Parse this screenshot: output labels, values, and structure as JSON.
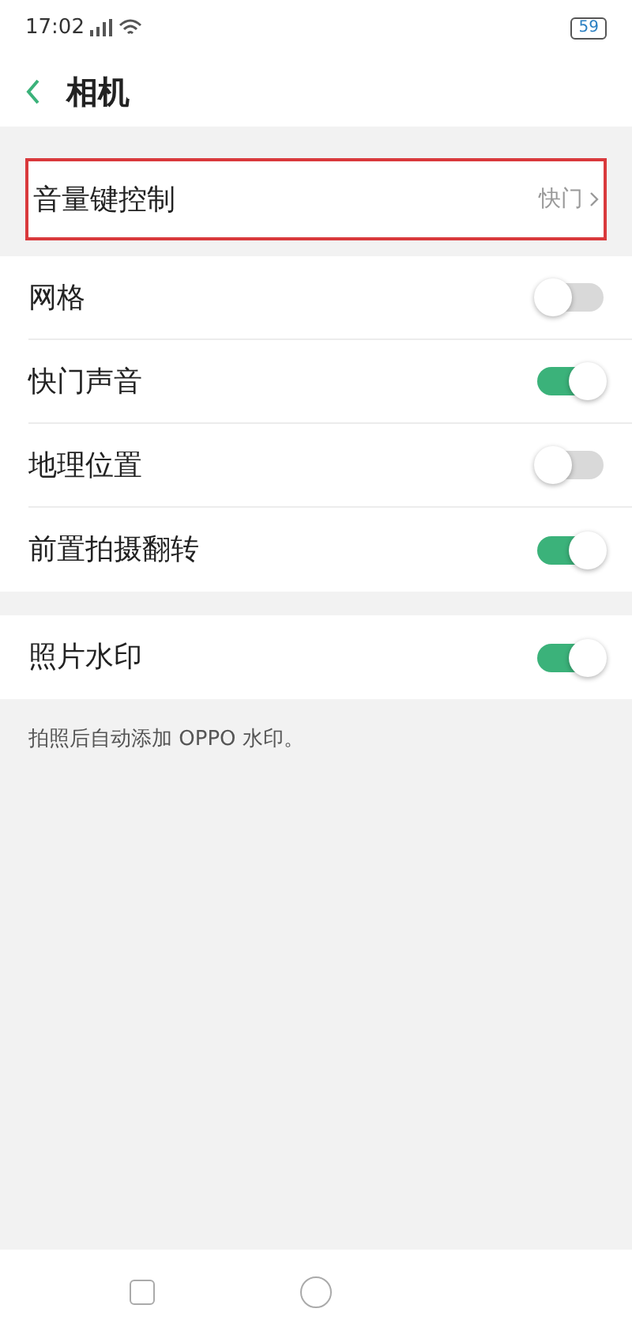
{
  "status_bar": {
    "time": "17:02",
    "battery": "59"
  },
  "header": {
    "title": "相机"
  },
  "volume_row": {
    "label": "音量键控制",
    "value": "快门",
    "highlighted": true
  },
  "toggles": [
    {
      "label": "网格",
      "on": false
    },
    {
      "label": "快门声音",
      "on": true
    },
    {
      "label": "地理位置",
      "on": false
    },
    {
      "label": "前置拍摄翻转",
      "on": true
    }
  ],
  "watermark_row": {
    "label": "照片水印",
    "on": true
  },
  "note": "拍照后自动添加 OPPO 水印。"
}
